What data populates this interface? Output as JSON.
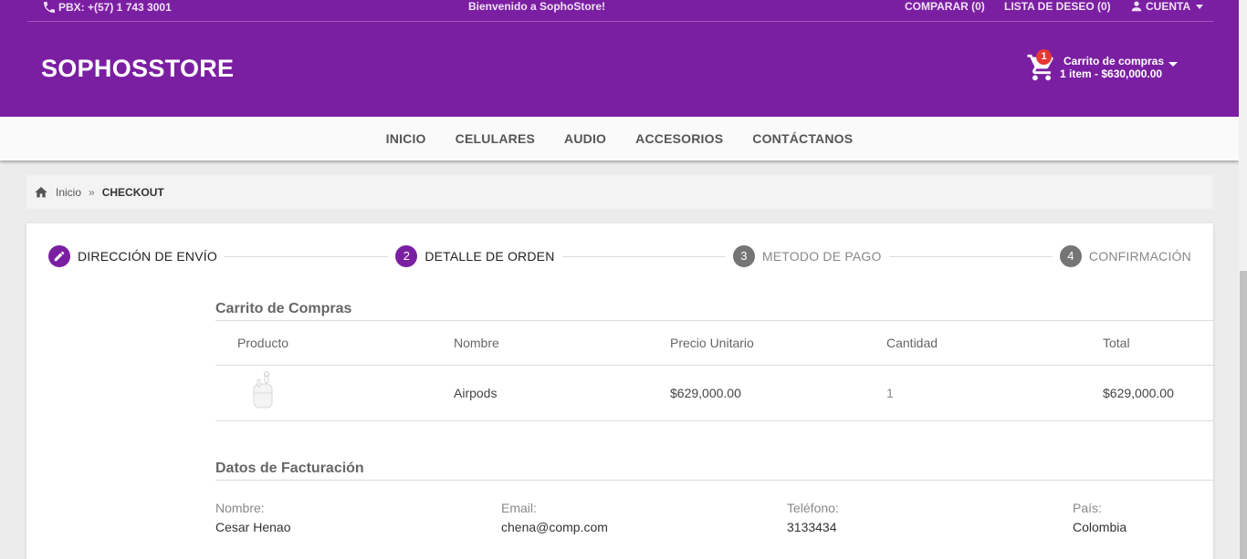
{
  "topbar": {
    "phone": "PBX: +(57) 1 743 3001",
    "welcome": "Bienvenido a SophoStore!",
    "compare": "COMPARAR (0)",
    "wishlist": "LISTA DE DESEO (0)",
    "account": "CUENTA"
  },
  "brand": {
    "name": "SOPHOSSTORE"
  },
  "cart": {
    "badge": "1",
    "title": "Carrito de compras",
    "summary": "1 item - $630,000.00"
  },
  "nav": {
    "items": [
      "INICIO",
      "CELULARES",
      "AUDIO",
      "ACCESORIOS",
      "CONTÁCTANOS"
    ]
  },
  "breadcrumb": {
    "home": "Inicio",
    "separator": "»",
    "current": "CHECKOUT"
  },
  "stepper": {
    "steps": [
      {
        "number": "",
        "label": "DIRECCIÓN DE ENVÍO",
        "state": "active"
      },
      {
        "number": "2",
        "label": "DETALLE DE ORDEN",
        "state": "active"
      },
      {
        "number": "3",
        "label": "METODO DE PAGO",
        "state": "inactive"
      },
      {
        "number": "4",
        "label": "CONFIRMACIÓN",
        "state": "inactive"
      }
    ]
  },
  "cart_table": {
    "title": "Carrito de Compras",
    "headers": [
      "Producto",
      "Nombre",
      "Precio Unitario",
      "Cantidad",
      "Total"
    ],
    "rows": [
      {
        "name": "Airpods",
        "unit_price": "$629,000.00",
        "quantity": "1",
        "total": "$629,000.00"
      }
    ]
  },
  "billing": {
    "title": "Datos de Facturación",
    "fields": [
      {
        "label": "Nombre:",
        "value": "Cesar Henao"
      },
      {
        "label": "Email:",
        "value": "chena@comp.com"
      },
      {
        "label": "Teléfono:",
        "value": "3133434"
      },
      {
        "label": "País:",
        "value": "Colombia"
      }
    ]
  },
  "colors": {
    "brand_purple": "#7b1fa2",
    "badge_red": "#e53935",
    "inactive_step": "#757575"
  }
}
